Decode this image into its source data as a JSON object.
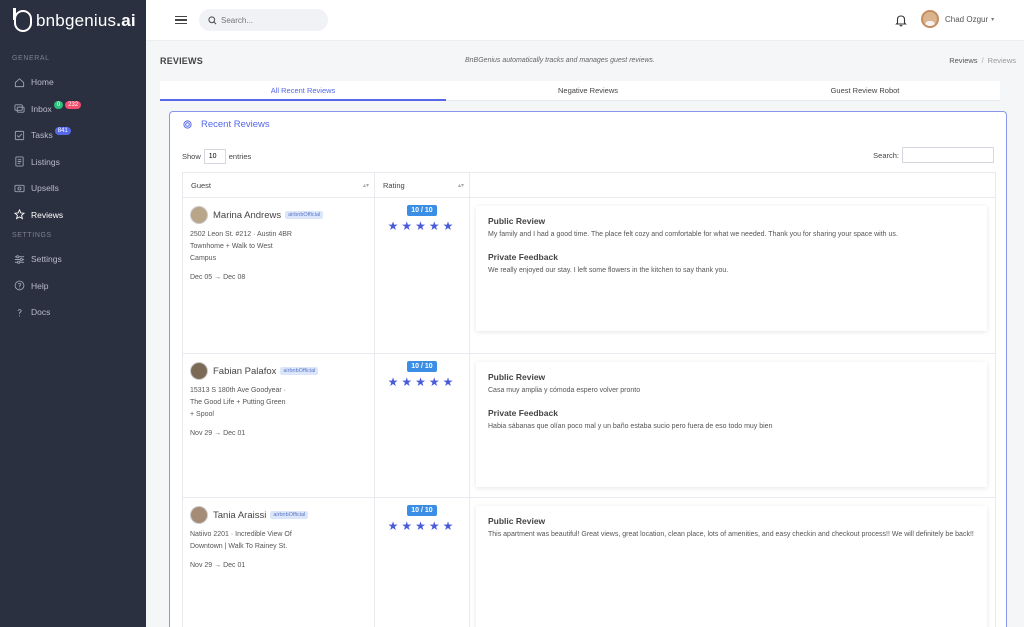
{
  "app": {
    "logo_text": "bnbgenius",
    "logo_suffix": ".ai"
  },
  "sidebar": {
    "section_general": "GENERAL",
    "section_settings": "SETTINGS",
    "items": [
      {
        "label": "Home",
        "icon": "home-icon"
      },
      {
        "label": "Inbox",
        "icon": "inbox-icon",
        "badges": [
          "0",
          "232"
        ]
      },
      {
        "label": "Tasks",
        "icon": "tasks-icon",
        "badges": [
          "841"
        ]
      },
      {
        "label": "Listings",
        "icon": "listings-icon"
      },
      {
        "label": "Upsells",
        "icon": "upsells-icon"
      },
      {
        "label": "Reviews",
        "icon": "star-icon",
        "active": true
      },
      {
        "label": "Settings",
        "icon": "sliders-icon"
      },
      {
        "label": "Help",
        "icon": "help-icon"
      },
      {
        "label": "Docs",
        "icon": "docs-icon"
      }
    ]
  },
  "topbar": {
    "search_placeholder": "Search...",
    "user_name": "Chad Ozgur"
  },
  "page": {
    "title": "REVIEWS",
    "description": "BnBGenius automatically tracks and manages guest reviews.",
    "breadcrumb": [
      "Reviews",
      "Reviews"
    ]
  },
  "tabs": [
    "All Recent Reviews",
    "Negative Reviews",
    "Guest Review Robot"
  ],
  "card": {
    "title": "Recent Reviews",
    "show_label": "Show",
    "show_value": "10",
    "entries_label": "entries",
    "search_label": "Search:"
  },
  "table": {
    "headers": [
      "Guest",
      "Rating"
    ],
    "public_label": "Public Review",
    "private_label": "Private Feedback",
    "rows": [
      {
        "name": "Marina Andrews",
        "tag": "airbnbOfficial",
        "address_lines": [
          "2502 Leon St. #212 · Austin 4BR",
          "Townhome + Walk to West",
          "Campus"
        ],
        "dates": "Dec 05 → Dec 08",
        "rating": "10 / 10",
        "stars": 5,
        "public_review": "My family and I had a good time. The place felt cozy and comfortable for what we needed. Thank you for sharing your space with us.",
        "private_feedback": "We really enjoyed our stay. I left some flowers in the kitchen to say thank you."
      },
      {
        "name": "Fabian Palafox",
        "tag": "airbnbOfficial",
        "address_lines": [
          "15313 S 180th Ave Goodyear ·",
          "The Good Life + Putting Green",
          "+ Spool"
        ],
        "dates": "Nov 29 → Dec 01",
        "rating": "10 / 10",
        "stars": 5,
        "public_review": "Casa muy amplia y cómoda espero volver pronto",
        "private_feedback": "Habia sábanas que olían poco mal y un baño estaba sucio pero fuera de eso todo muy bien"
      },
      {
        "name": "Tania Araissi",
        "tag": "airbnbOfficial",
        "address_lines": [
          "Natiivo 2201 · Incredible View Of",
          "Downtown | Walk To Rainey St."
        ],
        "dates": "Nov 29 → Dec 01",
        "rating": "10 / 10",
        "stars": 5,
        "public_review": "This apartment was beautiful! Great views, great location, clean place, lots of amenities, and easy checkin and checkout process!! We will definitely be back!!",
        "private_feedback": ""
      }
    ]
  },
  "colors": {
    "sidebar_bg": "#2b3040",
    "accent": "#5468e8",
    "rating_badge": "#3a8ee6"
  }
}
